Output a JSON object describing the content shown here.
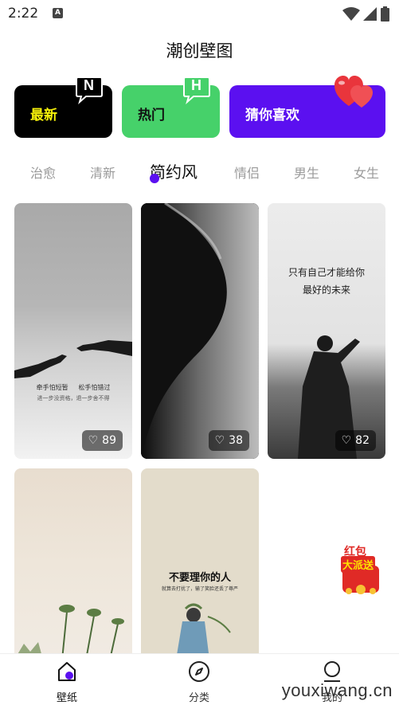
{
  "status_bar": {
    "time": "2:22",
    "notification_letter": "A",
    "icons": [
      "wifi-icon",
      "signal-icon",
      "battery-icon"
    ]
  },
  "header": {
    "title": "潮创壁图"
  },
  "feature_cards": [
    {
      "label": "最新",
      "badge_letter": "N",
      "badge_color": "#000000",
      "bg": "#000000",
      "text_color": "#f6f10a"
    },
    {
      "label": "热门",
      "badge_letter": "H",
      "badge_color": "#46d16a",
      "bg": "#46d16a",
      "text_color": "#111111"
    },
    {
      "label": "猜你喜欢",
      "badge_icon": "hearts-icon",
      "bg": "#5b10f0",
      "text_color": "#ffffff"
    }
  ],
  "categories": {
    "tabs": [
      "治愈",
      "清新",
      "简约风",
      "情侣",
      "男生",
      "女生"
    ],
    "active": "简约风",
    "accent": "#5b10f0"
  },
  "wallpapers": [
    {
      "likes": "89",
      "caption_left": "牵手怕短暂",
      "caption_right": "松手怕错过",
      "caption_sub": "进一步没资格，退一步舍不得"
    },
    {
      "likes": "38"
    },
    {
      "likes": "82",
      "quote_line1": "只有自己才能给你",
      "quote_line2": "最好的未来"
    },
    {},
    {
      "headline": "不要理你的人",
      "subline": "就算去打扰了，输了笑脸还丢了尊严"
    }
  ],
  "red_packet": {
    "line1": "红包",
    "line2": "大派送"
  },
  "bottom_nav": {
    "items": [
      {
        "label": "壁纸",
        "icon": "home-icon",
        "active": true
      },
      {
        "label": "分类",
        "icon": "compass-icon",
        "active": false
      },
      {
        "label": "我的",
        "icon": "profile-icon",
        "active": false
      }
    ]
  },
  "watermark": "youxiwang.cn"
}
